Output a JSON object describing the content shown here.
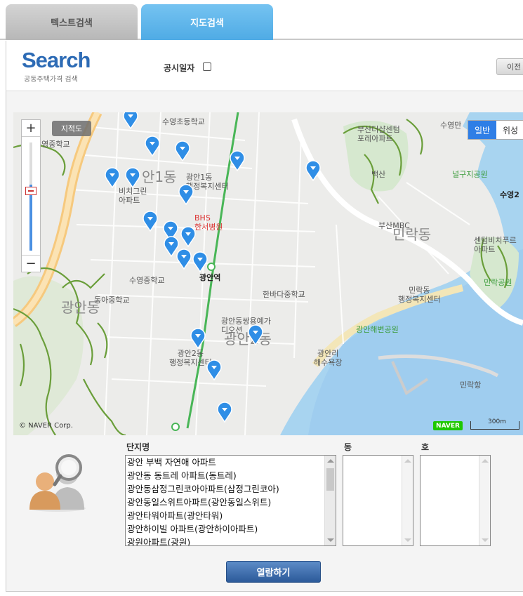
{
  "tabs": [
    {
      "label": "텍스트검색",
      "active": false
    },
    {
      "label": "지도검색",
      "active": true
    }
  ],
  "header": {
    "logo_text": "Search",
    "logo_subtitle": "공동주택가격 검색",
    "publication_date_label": "공시일자",
    "publication_date_checked": false,
    "prev_button": "이전"
  },
  "map": {
    "cadastral_button": "지적도",
    "map_type_options": [
      "일반",
      "위성"
    ],
    "map_type_selected": "일반",
    "copyright": "© NAVER Corp.",
    "provider_logo": "NAVER",
    "scale_label": "300m",
    "zoom_in": "+",
    "zoom_out": "−",
    "labels": {
      "suyeong_elem": "수영초등학교",
      "suyeong_mid": "수영중학교",
      "gwangan1dong": "안1동",
      "gwangan1_welfare": "광안1동\n행정복지센터",
      "bichi_green": "비치그린\n아파트",
      "bhs_hospital": "BHS\n한서병원",
      "suyeong_middle": "수영중학교",
      "dongan_middle": "동아중학교",
      "gwangan_st": "광안역",
      "hanbada": "한바다중학교",
      "gwangandong": "광안동",
      "gwangan2dong": "광안2동",
      "ssangyong": "광안동쌍용예가\n디오션",
      "gwangan_welfare": "광안2동\n행정복지센터",
      "busan_sanddeok": "부산더샵센텀\n포레아파트",
      "baeksan": "백산",
      "neolguji": "널구지공원",
      "suyeong2": "수영2",
      "busan_mbc": "부산MBC",
      "millak": "민락동",
      "centum_bichi": "센텀비치푸르\n아파트",
      "millak_park": "민락공원",
      "millak_welfare": "민락동\n행정복지센터",
      "gwangan_beach_park": "광안해변공원",
      "gwangalli_beach": "광안리\n해수욕장",
      "millak_port": "민락항",
      "suyeongman": "수영만"
    }
  },
  "selector": {
    "complex_label": "단지명",
    "dong_label": "동",
    "ho_label": "호",
    "complexes": [
      "광안 부백 자연애 아파트",
      "광안동 동트레 아파트(동트레)",
      "광안동삼정그린코아아파트(삼정그린코아)",
      "광안동일스위트아파트(광안동일스위트)",
      "광안타워아파트(광안타워)",
      "광안하이빌 아파트(광안하이아파트)",
      "광원아파트(광원)"
    ],
    "dong_items": [],
    "ho_items": []
  },
  "view_button": "열람하기",
  "colors": {
    "active_tab": "#4fabe5",
    "map_pin": "#2f8ee6",
    "view_button": "#2c5a9a"
  }
}
